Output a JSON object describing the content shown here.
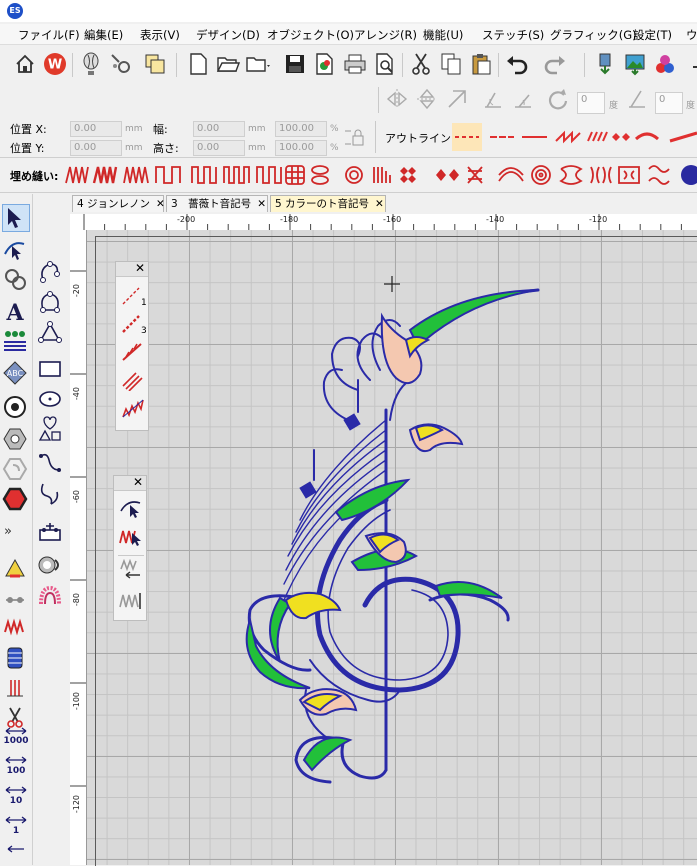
{
  "menu": [
    "ファイル(F)",
    "編集(E)",
    "表示(V)",
    "デザイン(D)",
    "オブジェクト(O)",
    "アレンジ(R)",
    "機能(U)",
    "ステッチ(S)",
    "グラフィック(G)",
    "設定(T)",
    "ウ"
  ],
  "props": {
    "pos_x_label": "位置 X:",
    "pos_y_label": "位置 Y:",
    "width_label": "幅:",
    "height_label": "高さ:",
    "pos_x_value": "0.00",
    "pos_y_value": "0.00",
    "width_value": "0.00",
    "height_value": "0.00",
    "scale_w_value": "100.00",
    "scale_h_value": "100.00",
    "unit_mm": "mm",
    "unit_pct": "%",
    "outline_label": "アウトライン:",
    "rotate_value": "0",
    "rotate_unit": "度",
    "skew_value": "0",
    "skew_unit": "度"
  },
  "fill_label": "埋め縫い:",
  "tabs": [
    {
      "label": "4 ジョンレノン",
      "close": "✕"
    },
    {
      "label": "3　薔薇ト音記号",
      "close": "✕"
    },
    {
      "label": "5 カラーのト音記号",
      "close": "✕"
    }
  ],
  "ruler": {
    "h_labels": [
      "-200",
      "-180",
      "-160",
      "-140",
      "-120"
    ],
    "v_labels": [
      "-20",
      "-40",
      "-60",
      "-80",
      "-100",
      "-120"
    ]
  },
  "left_labels": [
    "1000",
    "100",
    "10",
    "1"
  ],
  "palette_labels": [
    "1",
    "3"
  ],
  "colors": {
    "thread_blue": "#2a2aa8",
    "thread_green": "#22c03a",
    "thread_yellow": "#f0e020",
    "thread_peach": "#f4c8b0",
    "accent_red": "#e03030"
  }
}
